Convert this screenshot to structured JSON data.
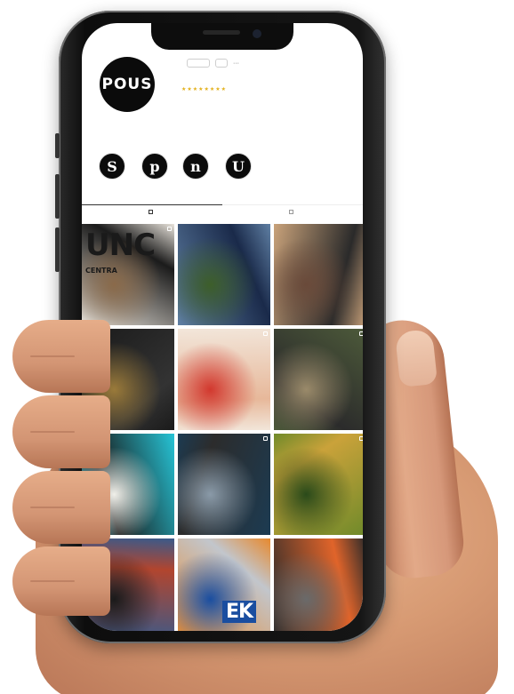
{
  "profile": {
    "avatar_small_text": "",
    "avatar_word": "POUS",
    "username": "",
    "follow_label": "",
    "message_label": "",
    "more_label": "···",
    "stats": [
      "",
      "",
      ""
    ],
    "bio_name": "",
    "bio_lines": [
      "",
      "",
      ""
    ],
    "bio_stars": "★★★★★★★★",
    "bio_link": ""
  },
  "highlights": [
    {
      "letter": "S",
      "label": ""
    },
    {
      "letter": "p",
      "label": ""
    },
    {
      "letter": "n",
      "label": ""
    },
    {
      "letter": "U",
      "label": ""
    }
  ],
  "tabs": [
    {
      "label": "",
      "active": true
    },
    {
      "label": "",
      "active": false
    }
  ],
  "grid": {
    "tiles": [
      {
        "name": "tile-poster-cyclist",
        "colors": [
          "#e9e4dc",
          "#1b1b1b",
          "#8a6a4a"
        ],
        "poster_text": "UNC",
        "poster_sub": "CENTRA"
      },
      {
        "name": "tile-race-winner",
        "colors": [
          "#5f7fa3",
          "#1a2a4a",
          "#3d5e2a"
        ],
        "poster_text": "",
        "poster_sub": ""
      },
      {
        "name": "tile-riders-legs",
        "colors": [
          "#c9a27a",
          "#2a2a2a",
          "#6a4a3a"
        ],
        "poster_text": "",
        "poster_sub": ""
      },
      {
        "name": "tile-bike-parts",
        "colors": [
          "#1a1a1a",
          "#333333",
          "#9a7a3a"
        ],
        "poster_text": "",
        "poster_sub": ""
      },
      {
        "name": "tile-hands-paper",
        "colors": [
          "#f2e6da",
          "#e7b89a",
          "#d2382e"
        ],
        "poster_text": "",
        "poster_sub": ""
      },
      {
        "name": "tile-gravel-rider",
        "colors": [
          "#4d5a3a",
          "#2b2b2b",
          "#9a8a6a"
        ],
        "poster_text": "",
        "poster_sub": ""
      },
      {
        "name": "tile-cyan-bike",
        "colors": [
          "#26c4d6",
          "#1a1a1a",
          "#f0efe9"
        ],
        "poster_text": "",
        "poster_sub": ""
      },
      {
        "name": "tile-crankset",
        "colors": [
          "#1c3b52",
          "#2c2c2c",
          "#8a9aa8"
        ],
        "poster_text": "",
        "poster_sub": ""
      },
      {
        "name": "tile-mtb-hill",
        "colors": [
          "#6f8a2a",
          "#caa23a",
          "#2a4a1a"
        ],
        "poster_text": "",
        "poster_sub": ""
      },
      {
        "name": "tile-peloton",
        "colors": [
          "#3a5a8a",
          "#b2452e",
          "#1a1a1a"
        ],
        "poster_text": "",
        "poster_sub": ""
      },
      {
        "name": "tile-fork-brand",
        "colors": [
          "#e7892e",
          "#c2c6cc",
          "#1a4ea0"
        ],
        "poster_text": "EK",
        "poster_sub": ""
      },
      {
        "name": "tile-bikes-crowd",
        "colors": [
          "#2a2a2a",
          "#e0642a",
          "#6a6a6a"
        ],
        "poster_text": "",
        "poster_sub": ""
      }
    ]
  }
}
